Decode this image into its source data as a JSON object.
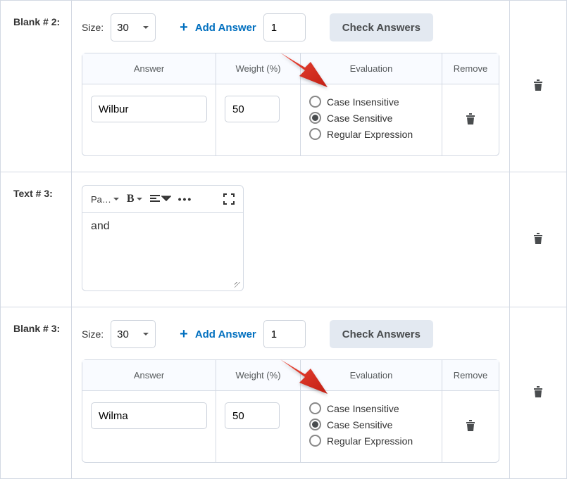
{
  "rows": [
    {
      "label": "Blank # 2:",
      "sizeLabel": "Size:",
      "sizeValue": "30",
      "addAnswer": "Add Answer",
      "countValue": "1",
      "checkBtn": "Check Answers",
      "headers": {
        "answer": "Answer",
        "weight": "Weight (%)",
        "evaluation": "Evaluation",
        "remove": "Remove"
      },
      "answerValue": "Wilbur",
      "weightValue": "50",
      "eval": {
        "opt1": "Case Insensitive",
        "opt2": "Case Sensitive",
        "opt3": "Regular Expression",
        "selected": 1
      }
    },
    {
      "label": "Text # 3:",
      "rte": {
        "paragraph": "Pa…",
        "bold": "B",
        "content": "and"
      }
    },
    {
      "label": "Blank # 3:",
      "sizeLabel": "Size:",
      "sizeValue": "30",
      "addAnswer": "Add Answer",
      "countValue": "1",
      "checkBtn": "Check Answers",
      "headers": {
        "answer": "Answer",
        "weight": "Weight (%)",
        "evaluation": "Evaluation",
        "remove": "Remove"
      },
      "answerValue": "Wilma",
      "weightValue": "50",
      "eval": {
        "opt1": "Case Insensitive",
        "opt2": "Case Sensitive",
        "opt3": "Regular Expression",
        "selected": 1
      }
    }
  ]
}
